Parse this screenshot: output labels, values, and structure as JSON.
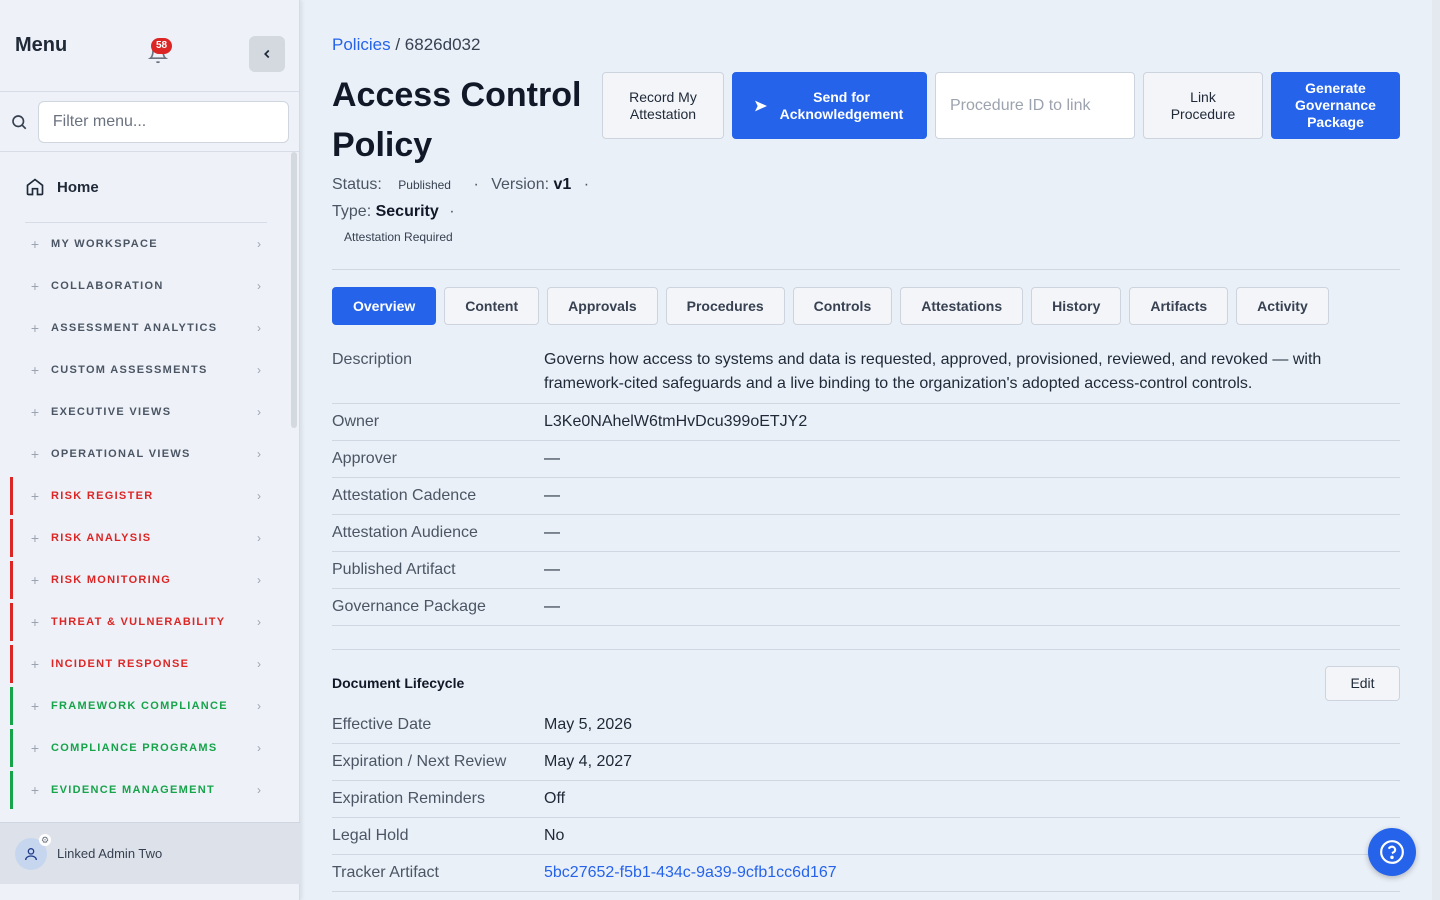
{
  "sidebar": {
    "title": "Menu",
    "notifications": "58",
    "filter_placeholder": "Filter menu...",
    "home_label": "Home",
    "groups": [
      {
        "label": "MY WORKSPACE",
        "tone": "default"
      },
      {
        "label": "COLLABORATION",
        "tone": "default"
      },
      {
        "label": "ASSESSMENT ANALYTICS",
        "tone": "default"
      },
      {
        "label": "CUSTOM ASSESSMENTS",
        "tone": "default"
      },
      {
        "label": "EXECUTIVE VIEWS",
        "tone": "default"
      },
      {
        "label": "OPERATIONAL VIEWS",
        "tone": "default"
      },
      {
        "label": "RISK REGISTER",
        "tone": "red"
      },
      {
        "label": "RISK ANALYSIS",
        "tone": "red"
      },
      {
        "label": "RISK MONITORING",
        "tone": "red"
      },
      {
        "label": "THREAT & VULNERABILITY",
        "tone": "red"
      },
      {
        "label": "INCIDENT RESPONSE",
        "tone": "red"
      },
      {
        "label": "FRAMEWORK COMPLIANCE",
        "tone": "green"
      },
      {
        "label": "COMPLIANCE PROGRAMS",
        "tone": "green"
      },
      {
        "label": "EVIDENCE MANAGEMENT",
        "tone": "green"
      }
    ],
    "user_name": "Linked Admin Two"
  },
  "breadcrumb": {
    "parent": "Policies",
    "separator": "/",
    "current": "6826d032"
  },
  "page": {
    "title": "Access Control Policy",
    "status_label": "Status:",
    "status_value": "Published",
    "version_label": "Version:",
    "version_value": "v1",
    "type_label": "Type:",
    "type_value": "Security",
    "dot": "·",
    "attestation_note": "Attestation Required"
  },
  "actions": {
    "record": "Record My Attestation",
    "send": "Send for Acknowledgement",
    "procedure_placeholder": "Procedure ID to link",
    "link": "Link Procedure",
    "generate": "Generate Governance Package"
  },
  "tabs": [
    "Overview",
    "Content",
    "Approvals",
    "Procedures",
    "Controls",
    "Attestations",
    "History",
    "Artifacts",
    "Activity"
  ],
  "active_tab": "Overview",
  "details": {
    "description_label": "Description",
    "description_value": "Governs how access to systems and data is requested, approved, provisioned, reviewed, and revoked — with framework-cited safeguards and a live binding to the organization's adopted access-control controls.",
    "rows": [
      {
        "label": "Owner",
        "value": "L3Ke0NAhelW6tmHvDcu399oETJY2"
      },
      {
        "label": "Approver",
        "value": "—"
      },
      {
        "label": "Attestation Cadence",
        "value": "—"
      },
      {
        "label": "Attestation Audience",
        "value": "—"
      },
      {
        "label": "Published Artifact",
        "value": "—"
      },
      {
        "label": "Governance Package",
        "value": "—"
      }
    ]
  },
  "lifecycle": {
    "title": "Document Lifecycle",
    "edit_label": "Edit",
    "rows": [
      {
        "label": "Effective Date",
        "value": "May 5, 2026"
      },
      {
        "label": "Expiration / Next Review",
        "value": "May 4, 2027"
      },
      {
        "label": "Expiration Reminders",
        "value": "Off"
      },
      {
        "label": "Legal Hold",
        "value": "No"
      },
      {
        "label": "Tracker Artifact",
        "value": "5bc27652-f5b1-434c-9a39-9cfb1cc6d167"
      }
    ]
  },
  "colors": {
    "primary": "#2563eb",
    "danger": "#dc2626",
    "success": "#16a34a"
  }
}
